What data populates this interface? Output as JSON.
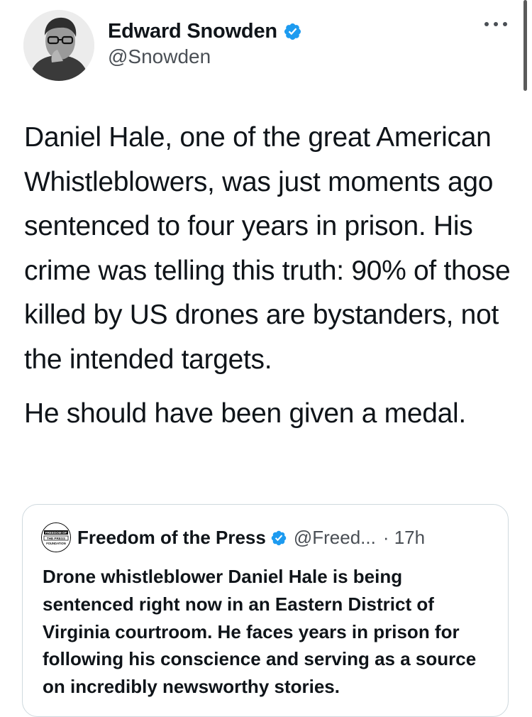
{
  "author": {
    "name": "Edward Snowden",
    "handle": "@Snowden",
    "verified": true
  },
  "menu": {
    "icon": "more-icon"
  },
  "tweet": {
    "paragraphs": [
      "Daniel Hale, one of the great American Whistleblowers, was just moments ago sentenced to four years in prison. His crime was telling this truth: 90% of those killed by US drones are bystanders, not the intended targets.",
      "He should have been given a medal."
    ]
  },
  "quoted_tweet": {
    "name": "Freedom of the Press",
    "handle": "@Freed...",
    "time": "· 17h",
    "verified": true,
    "text": "Drone whistleblower Daniel Hale is being sentenced right now in an Eastern District of Virginia courtroom. He faces years in prison for following his conscience and serving as a source on incredibly newsworthy stories.",
    "logo_text": [
      "FREEDOM OF",
      "THE PRESS",
      "FOUNDATION"
    ]
  },
  "colors": {
    "verified_blue": "#1d9bf0",
    "text": "#0f1419",
    "secondary_text": "#4a4f55",
    "border": "#cfd9de"
  }
}
